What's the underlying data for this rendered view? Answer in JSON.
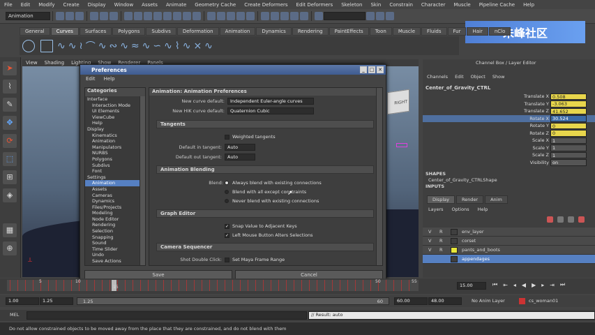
{
  "menubar": [
    "File",
    "Edit",
    "Modify",
    "Create",
    "Display",
    "Window",
    "Assets",
    "Animate",
    "Geometry Cache",
    "Create Deformers",
    "Edit Deformers",
    "Skeleton",
    "Skin",
    "Constrain",
    "Character",
    "Muscle",
    "Pipeline Cache",
    "Help"
  ],
  "toolbar": {
    "mode": "Animation"
  },
  "shelf_tabs": [
    "General",
    "Curves",
    "Surfaces",
    "Polygons",
    "Subdivs",
    "Deformation",
    "Animation",
    "Dynamics",
    "Rendering",
    "PaintEffects",
    "Toon",
    "Muscle",
    "Fluids",
    "Fur",
    "Hair",
    "nClo"
  ],
  "shelf_active": "Curves",
  "watermark": "朱峰社区",
  "viewport": {
    "menu": [
      "View",
      "Shading",
      "Lighting",
      "Show",
      "Renderer",
      "Panels"
    ],
    "cube_label": "RIGHT"
  },
  "dialog": {
    "title": "Preferences",
    "menu": [
      "Edit",
      "Help"
    ],
    "categories_header": "Categories",
    "categories": [
      {
        "label": "Interface",
        "level": 0
      },
      {
        "label": "Interaction Mode",
        "level": 1
      },
      {
        "label": "UI Elements",
        "level": 1
      },
      {
        "label": "ViewCube",
        "level": 1
      },
      {
        "label": "Help",
        "level": 1
      },
      {
        "label": "Display",
        "level": 0
      },
      {
        "label": "Kinematics",
        "level": 1
      },
      {
        "label": "Animation",
        "level": 1
      },
      {
        "label": "Manipulators",
        "level": 1
      },
      {
        "label": "NURBS",
        "level": 1
      },
      {
        "label": "Polygons",
        "level": 1
      },
      {
        "label": "Subdivs",
        "level": 1
      },
      {
        "label": "Font",
        "level": 1
      },
      {
        "label": "Settings",
        "level": 0
      },
      {
        "label": "Animation",
        "level": 1,
        "selected": true
      },
      {
        "label": "Assets",
        "level": 1
      },
      {
        "label": "Cameras",
        "level": 1
      },
      {
        "label": "Dynamics",
        "level": 1
      },
      {
        "label": "Files/Projects",
        "level": 1
      },
      {
        "label": "Modeling",
        "level": 1
      },
      {
        "label": "Node Editor",
        "level": 1
      },
      {
        "label": "Rendering",
        "level": 1
      },
      {
        "label": "Selection",
        "level": 1
      },
      {
        "label": "Snapping",
        "level": 1
      },
      {
        "label": "Sound",
        "level": 1
      },
      {
        "label": "Time Slider",
        "level": 1
      },
      {
        "label": "Undo",
        "level": 1
      },
      {
        "label": "Save Actions",
        "level": 1
      }
    ],
    "pane_header": "Animation: Animation Preferences",
    "new_curve_label": "New curve default:",
    "new_curve_value": "Independent Euler-angle curves",
    "new_hik_label": "New HIK curve default:",
    "new_hik_value": "Quaternion Cubic",
    "tangents_header": "Tangents",
    "weighted_tangents": "Weighted tangents",
    "in_tangent_label": "Default in tangent:",
    "in_tangent_value": "Auto",
    "out_tangent_label": "Default out tangent:",
    "out_tangent_value": "Auto",
    "blending_header": "Animation Blending",
    "blend_label": "Blend:",
    "blend_options": [
      "Always blend with existing connections",
      "Blend with all except constraints",
      "Never blend with existing connections"
    ],
    "graph_header": "Graph Editor",
    "graph_options": [
      "Snap Value to Adjacent Keys",
      "Left Mouse Button Alters Selections"
    ],
    "camera_header": "Camera Sequencer",
    "shot_label": "Shot Double Click:",
    "shot_value": "Set Maya Frame Range",
    "save_btn": "Save",
    "cancel_btn": "Cancel"
  },
  "channelbox": {
    "title": "Channel Box / Layer Editor",
    "menu": [
      "Channels",
      "Edit",
      "Object",
      "Show"
    ],
    "object": "Center_of_Gravity_CTRL",
    "attrs": [
      {
        "name": "Translate X",
        "value": "0.508",
        "style": "yellow"
      },
      {
        "name": "Translate Y",
        "value": "-3.063",
        "style": "yellow"
      },
      {
        "name": "Translate Z",
        "value": "41.652",
        "style": "yellow"
      },
      {
        "name": "Rotate X",
        "value": "30.524",
        "style": "blue"
      },
      {
        "name": "Rotate Y",
        "value": "0",
        "style": "yellow"
      },
      {
        "name": "Rotate Z",
        "value": "0",
        "style": "yellow"
      },
      {
        "name": "Scale X",
        "value": "1",
        "style": "grey"
      },
      {
        "name": "Scale Y",
        "value": "1",
        "style": "grey"
      },
      {
        "name": "Scale Z",
        "value": "1",
        "style": "grey"
      },
      {
        "name": "Visibility",
        "value": "on",
        "style": "grey"
      }
    ],
    "shapes_header": "SHAPES",
    "shape": "Center_of_Gravity_CTRLShape",
    "inputs_header": "INPUTS",
    "layer_tabs": [
      "Display",
      "Render",
      "Anim"
    ],
    "layer_menu": [
      "Layers",
      "Options",
      "Help"
    ],
    "layers": [
      {
        "v": "V",
        "r": "R",
        "name": "env_layer",
        "color": "#3f3f3f"
      },
      {
        "v": "V",
        "r": "R",
        "name": "corset",
        "color": "#3f3f3f"
      },
      {
        "v": "V",
        "r": "R",
        "name": "pants_and_boots",
        "color": "#e6e63a"
      },
      {
        "v": "",
        "r": "",
        "name": "appendages",
        "color": "#3f3f3f",
        "selected": true
      }
    ]
  },
  "timeline": {
    "ticks": [
      "5",
      "10",
      "15",
      "50",
      "55"
    ],
    "current_frame": "15.00"
  },
  "range": {
    "start": "1.00",
    "start2": "1.25",
    "range_start": "1.25",
    "range_end": "60",
    "end": "60.00",
    "end2": "48.00",
    "anim_layer": "No Anim Layer",
    "character": "cs_woman01"
  },
  "cmd": {
    "label": "MEL",
    "result": "// Result: auto"
  },
  "help_text": "Do not allow constrained objects to be moved away from the place that they are constrained, and do not blend with them"
}
